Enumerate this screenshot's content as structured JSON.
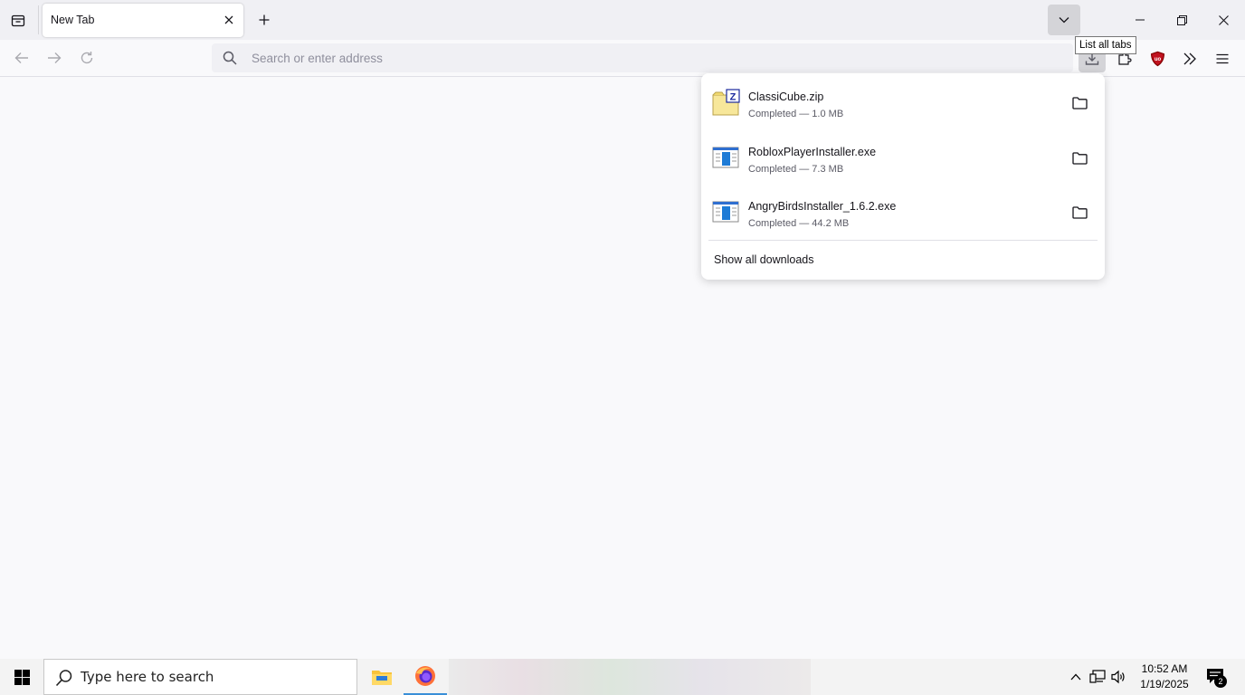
{
  "tabstrip": {
    "active_tab_title": "New Tab",
    "tooltip": "List all tabs"
  },
  "navbar": {
    "url_placeholder": "Search or enter address"
  },
  "downloads": {
    "items": [
      {
        "name": "ClassiCube.zip",
        "status": "Completed — 1.0 MB",
        "icon": "zip-archive-icon"
      },
      {
        "name": "RobloxPlayerInstaller.exe",
        "status": "Completed — 7.3 MB",
        "icon": "executable-icon"
      },
      {
        "name": "AngryBirdsInstaller_1.6.2.exe",
        "status": "Completed — 44.2 MB",
        "icon": "executable-icon"
      }
    ],
    "show_all_label": "Show all downloads"
  },
  "taskbar": {
    "search_placeholder": "Type here to search",
    "time": "10:52 AM",
    "date": "1/19/2025",
    "notification_count": "2"
  },
  "colors": {
    "accent": "#3a8fd8",
    "ublock_red": "#c1121f"
  }
}
